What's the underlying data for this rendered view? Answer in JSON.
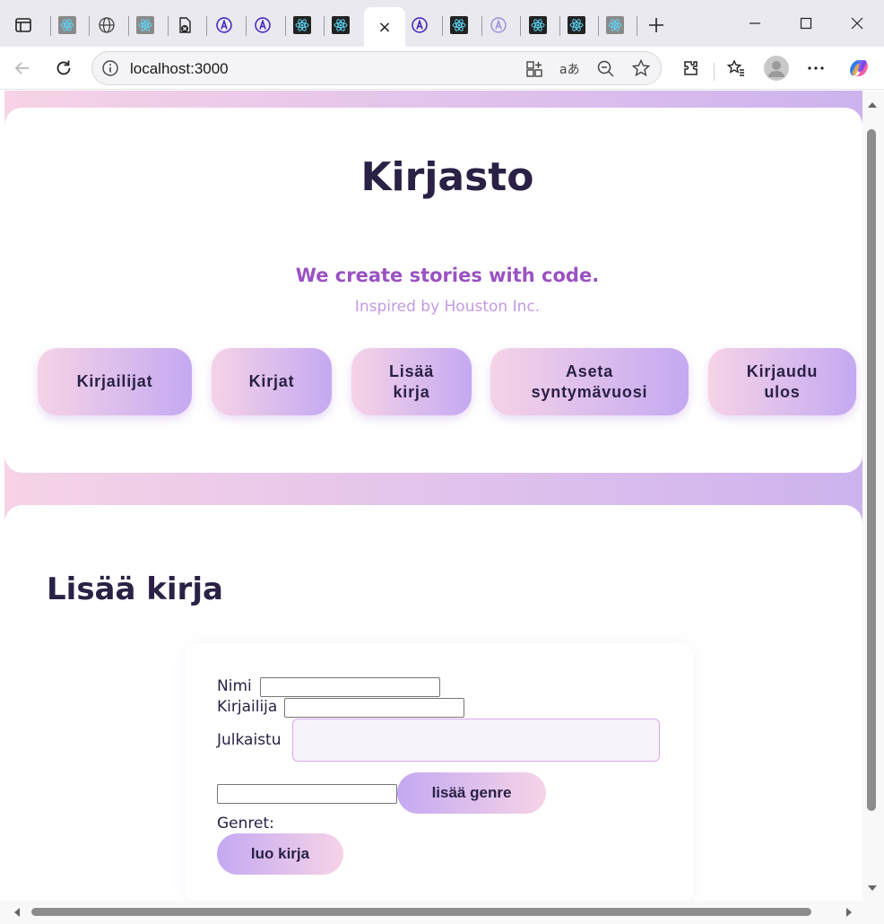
{
  "browser": {
    "url": "localhost:3000",
    "active_tab_close": "×"
  },
  "header": {
    "title": "Kirjasto",
    "tagline": "We create stories with code.",
    "subtagline": "Inspired by Houston Inc."
  },
  "nav": {
    "authors": "Kirjailijat",
    "books": "Kirjat",
    "add_book": "Lisää kirja",
    "set_birthyear": "Aseta syntymävuosi",
    "logout": "Kirjaudu ulos"
  },
  "main": {
    "section_title": "Lisää kirja",
    "form": {
      "title_label": "Nimi",
      "title_value": "",
      "author_label": "Kirjailija",
      "author_value": "",
      "published_label": "Julkaistu",
      "published_value": "",
      "genre_value": "",
      "add_genre_button": "lisää genre",
      "genres_label": "Genret:",
      "create_button": "luo kirja"
    }
  },
  "colors": {
    "accent_pink": "#f6d3e6",
    "accent_lavender": "#c4a9f2",
    "text_dark": "#2a2145",
    "tagline_purple": "#9a52c3"
  }
}
